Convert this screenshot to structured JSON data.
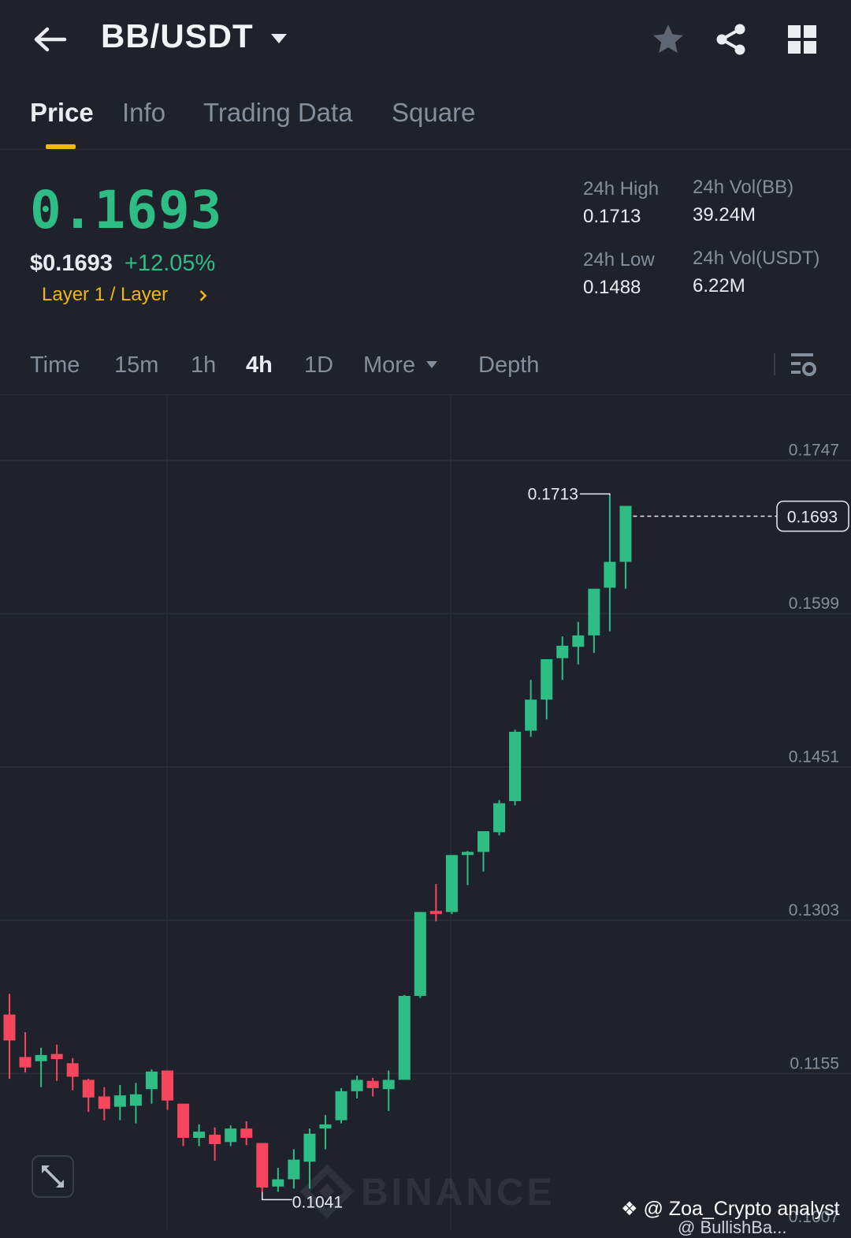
{
  "header": {
    "pair": "BB/USDT",
    "icons": [
      "back-arrow-icon",
      "caret-down-icon",
      "star-icon",
      "share-icon",
      "grid-icon"
    ]
  },
  "tabs": [
    {
      "label": "Price",
      "active": true
    },
    {
      "label": "Info",
      "active": false
    },
    {
      "label": "Trading Data",
      "active": false
    },
    {
      "label": "Square",
      "active": false
    }
  ],
  "ticker": {
    "last_price": "0.1693",
    "usd_price": "$0.1693",
    "change_pct": "+12.05%",
    "category": "Layer 1 / Layer",
    "high_label": "24h High",
    "high_value": "0.1713",
    "low_label": "24h Low",
    "low_value": "0.1488",
    "vol_base_label": "24h Vol(BB)",
    "vol_base_value": "39.24M",
    "vol_quote_label": "24h Vol(USDT)",
    "vol_quote_value": "6.22M"
  },
  "intervals": {
    "items": [
      "Time",
      "15m",
      "1h",
      "4h",
      "1D"
    ],
    "active": "4h",
    "more_label": "More",
    "depth_label": "Depth"
  },
  "colors": {
    "up": "#2ebd85",
    "down": "#f6465d",
    "accent": "#f0b90b",
    "background": "#1f222b"
  },
  "chart_data": {
    "type": "candlestick",
    "interval": "4h",
    "y_ticks": [
      "0.1747",
      "0.1599",
      "0.1451",
      "0.1303",
      "0.1155",
      "0.1007"
    ],
    "ylim": [
      0.1007,
      0.1778
    ],
    "last_price_label": "0.1693",
    "high_marker": "0.1713",
    "low_marker": "0.1041",
    "watermark": "BINANCE",
    "candles": [
      {
        "o": 0.1212,
        "h": 0.1232,
        "l": 0.115,
        "c": 0.1187
      },
      {
        "o": 0.1171,
        "h": 0.1195,
        "l": 0.1156,
        "c": 0.1161
      },
      {
        "o": 0.1167,
        "h": 0.118,
        "l": 0.1142,
        "c": 0.1173
      },
      {
        "o": 0.1174,
        "h": 0.1183,
        "l": 0.1148,
        "c": 0.1169
      },
      {
        "o": 0.1165,
        "h": 0.117,
        "l": 0.1139,
        "c": 0.1152
      },
      {
        "o": 0.1149,
        "h": 0.115,
        "l": 0.1118,
        "c": 0.1132
      },
      {
        "o": 0.1133,
        "h": 0.1142,
        "l": 0.111,
        "c": 0.1121
      },
      {
        "o": 0.1123,
        "h": 0.1144,
        "l": 0.111,
        "c": 0.1134
      },
      {
        "o": 0.1124,
        "h": 0.1146,
        "l": 0.1107,
        "c": 0.1135
      },
      {
        "o": 0.114,
        "h": 0.1159,
        "l": 0.1126,
        "c": 0.1157
      },
      {
        "o": 0.1158,
        "h": 0.1158,
        "l": 0.112,
        "c": 0.1129
      },
      {
        "o": 0.1126,
        "h": 0.1126,
        "l": 0.1085,
        "c": 0.1093
      },
      {
        "o": 0.1093,
        "h": 0.1106,
        "l": 0.1085,
        "c": 0.1099
      },
      {
        "o": 0.1096,
        "h": 0.1103,
        "l": 0.1071,
        "c": 0.1087
      },
      {
        "o": 0.1089,
        "h": 0.1105,
        "l": 0.1085,
        "c": 0.1102
      },
      {
        "o": 0.1102,
        "h": 0.1109,
        "l": 0.1086,
        "c": 0.1093
      },
      {
        "o": 0.1088,
        "h": 0.1088,
        "l": 0.1041,
        "c": 0.1045
      },
      {
        "o": 0.1046,
        "h": 0.1064,
        "l": 0.1041,
        "c": 0.1053
      },
      {
        "o": 0.1053,
        "h": 0.1082,
        "l": 0.1044,
        "c": 0.1072
      },
      {
        "o": 0.107,
        "h": 0.1102,
        "l": 0.1044,
        "c": 0.1097
      },
      {
        "o": 0.1102,
        "h": 0.1115,
        "l": 0.1082,
        "c": 0.1106
      },
      {
        "o": 0.111,
        "h": 0.1141,
        "l": 0.1107,
        "c": 0.1138
      },
      {
        "o": 0.1138,
        "h": 0.1153,
        "l": 0.1131,
        "c": 0.1149
      },
      {
        "o": 0.1148,
        "h": 0.1151,
        "l": 0.1133,
        "c": 0.1141
      },
      {
        "o": 0.114,
        "h": 0.1158,
        "l": 0.1119,
        "c": 0.1149
      },
      {
        "o": 0.1149,
        "h": 0.1231,
        "l": 0.1149,
        "c": 0.123
      },
      {
        "o": 0.123,
        "h": 0.1311,
        "l": 0.1228,
        "c": 0.1311
      },
      {
        "o": 0.1312,
        "h": 0.1338,
        "l": 0.1302,
        "c": 0.1309
      },
      {
        "o": 0.1311,
        "h": 0.1358,
        "l": 0.1309,
        "c": 0.1366
      },
      {
        "o": 0.1366,
        "h": 0.137,
        "l": 0.1337,
        "c": 0.1369
      },
      {
        "o": 0.1369,
        "h": 0.1385,
        "l": 0.135,
        "c": 0.1389
      },
      {
        "o": 0.1388,
        "h": 0.1419,
        "l": 0.1385,
        "c": 0.1416
      },
      {
        "o": 0.1418,
        "h": 0.1487,
        "l": 0.1414,
        "c": 0.1485
      },
      {
        "o": 0.1486,
        "h": 0.1535,
        "l": 0.148,
        "c": 0.1516
      },
      {
        "o": 0.1516,
        "h": 0.155,
        "l": 0.1497,
        "c": 0.1555
      },
      {
        "o": 0.1556,
        "h": 0.1577,
        "l": 0.1535,
        "c": 0.1568
      },
      {
        "o": 0.1567,
        "h": 0.1591,
        "l": 0.155,
        "c": 0.1578
      },
      {
        "o": 0.1578,
        "h": 0.1605,
        "l": 0.1561,
        "c": 0.1623
      },
      {
        "o": 0.1624,
        "h": 0.1713,
        "l": 0.1582,
        "c": 0.1649
      },
      {
        "o": 0.1649,
        "h": 0.1701,
        "l": 0.1623,
        "c": 0.1703
      }
    ]
  },
  "watermark_user": "@ Zoa_Crypto analyst",
  "watermark_user2": "@ BullishBa..."
}
